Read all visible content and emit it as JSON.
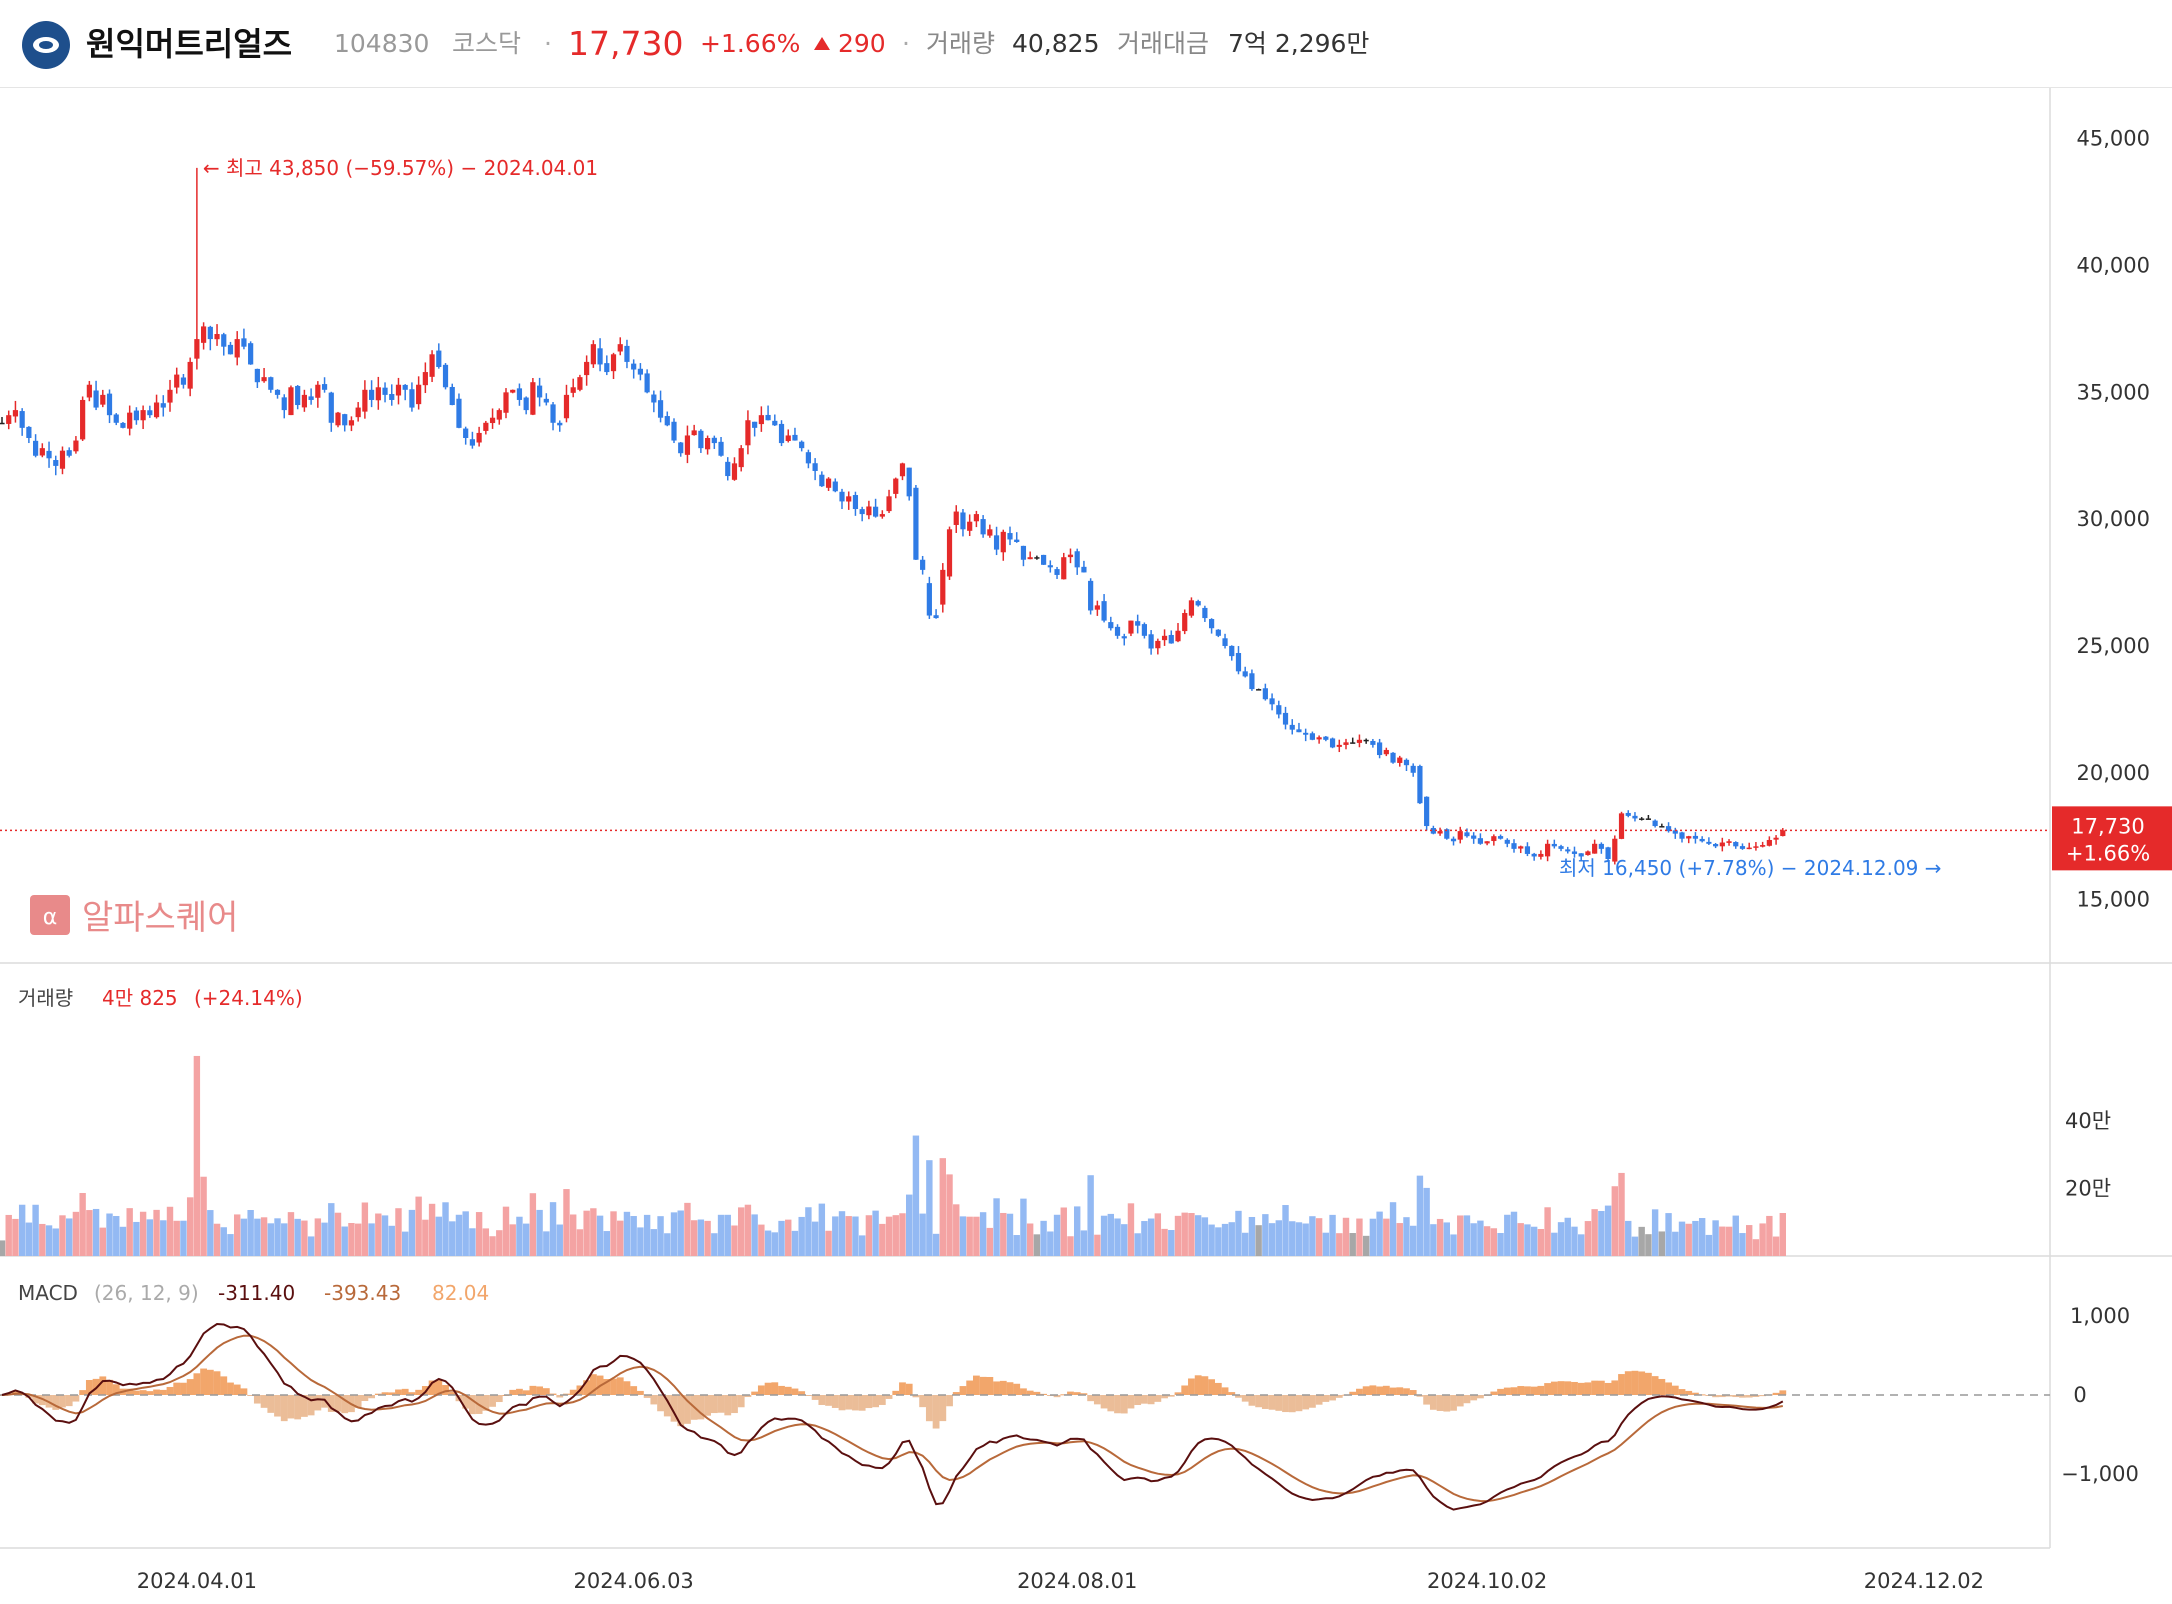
{
  "header": {
    "name": "원익머트리얼즈",
    "code": "104830",
    "market": "코스닥",
    "dot": "·",
    "price": "17,730",
    "change_pct": "+1.66%",
    "change_amt": "290",
    "volume_label": "거래량",
    "volume_value": "40,825",
    "amount_label": "거래대금",
    "amount_value": "7억 2,296만"
  },
  "watermark": {
    "icon": "α",
    "text": "알파스퀘어"
  },
  "colors": {
    "up": "#e52a2a",
    "down": "#2f7be5",
    "flat": "#222222",
    "vol_up": "#f4a3a3",
    "vol_down": "#93b9f3",
    "vol_flat": "#a7a7a7",
    "macd": "#5a0f0f",
    "signal": "#b8693a",
    "hist_pos": "#f2a66b",
    "hist_neg": "#ebbd98"
  },
  "chart_data": {
    "type": "candlestick",
    "price_axis": {
      "ticks": [
        "45,000",
        "40,000",
        "35,000",
        "30,000",
        "25,000",
        "20,000",
        "15,000"
      ],
      "values": [
        45000,
        40000,
        35000,
        30000,
        25000,
        20000,
        15000
      ],
      "range": [
        12500,
        47000
      ]
    },
    "date_ticks": [
      "2024.04.01",
      "2024.06.03",
      "2024.08.01",
      "2024.10.02",
      "2024.12.02"
    ],
    "date_tick_index": [
      29,
      94,
      160,
      221,
      286
    ],
    "current_price": {
      "label": "17,730",
      "pct": "+1.66%",
      "value": 17730
    },
    "high_annotation": {
      "text": "← 최고 43,850 (−59.57%) − 2024.04.01",
      "value": 43850,
      "index": 29
    },
    "low_annotation": {
      "text": "최저 16,450 (+7.78%) − 2024.12.09 →",
      "value": 16450,
      "index": 291
    },
    "close": [
      33800,
      34100,
      34300,
      33600,
      33200,
      32500,
      32800,
      32400,
      32100,
      32700,
      32500,
      33100,
      34700,
      35300,
      34400,
      34900,
      34100,
      33800,
      33600,
      34200,
      33900,
      34300,
      34100,
      34600,
      34400,
      35100,
      35700,
      35300,
      36200,
      37100,
      37600,
      37100,
      37300,
      36800,
      36500,
      37100,
      36800,
      36100,
      35400,
      35600,
      35100,
      34900,
      34300,
      35200,
      34500,
      34900,
      34700,
      35300,
      35100,
      33800,
      34200,
      33700,
      33900,
      34400,
      35100,
      34700,
      35200,
      34900,
      34700,
      35300,
      35100,
      34400,
      35300,
      35800,
      36500,
      36000,
      35200,
      34500,
      33600,
      33200,
      32900,
      33400,
      33800,
      34000,
      34300,
      35000,
      35100,
      34700,
      34300,
      35400,
      34800,
      34600,
      33800,
      33700,
      34900,
      35200,
      35600,
      36200,
      36900,
      36100,
      35800,
      36500,
      36900,
      36200,
      35900,
      35700,
      35000,
      34600,
      34000,
      33700,
      33100,
      32600,
      33300,
      33500,
      32800,
      33200,
      33000,
      32500,
      31700,
      32200,
      32800,
      33900,
      33600,
      34100,
      33900,
      33700,
      33000,
      33300,
      33100,
      32800,
      32200,
      31900,
      31300,
      31600,
      31100,
      30700,
      30900,
      30400,
      30200,
      30500,
      30100,
      30200,
      30900,
      31600,
      32200,
      30900,
      28400,
      28000,
      26200,
      26100,
      28000,
      29600,
      30300,
      29600,
      29900,
      30200,
      29400,
      29600,
      28800,
      29500,
      29200,
      29100,
      28400,
      28500,
      28500,
      28200,
      28100,
      27800,
      28500,
      28600,
      28100,
      27900,
      26400,
      26600,
      26000,
      25700,
      25400,
      25300,
      26000,
      25800,
      25400,
      24900,
      25200,
      25400,
      25100,
      25600,
      26300,
      26800,
      26600,
      26100,
      25700,
      25400,
      25000,
      24600,
      24000,
      23800,
      23300,
      23300,
      22900,
      22700,
      22300,
      21900,
      21700,
      21600,
      21500,
      21300,
      21400,
      21300,
      21000,
      21100,
      21200,
      21200,
      21300,
      21300,
      21100,
      20700,
      20900,
      20400,
      20600,
      20300,
      20000,
      18800,
      17900,
      17600,
      17700,
      17400,
      17300,
      17700,
      17500,
      17400,
      17200,
      17300,
      17500,
      17400,
      17200,
      17000,
      17100,
      16800,
      16700,
      16800,
      17200,
      17100,
      17000,
      16900,
      16800,
      16700,
      16900,
      17200,
      17000,
      16600,
      17400,
      18400,
      18300,
      18200,
      18200,
      18200,
      17900,
      17900,
      17700,
      17600,
      17400,
      17500,
      17400,
      17300,
      17200,
      17100,
      17250,
      17300,
      17100,
      17000,
      17050,
      17100,
      17150,
      17350,
      17440,
      17730
    ],
    "x": "trading days 2024.03 – 2024.12, one value per day",
    "volume_axis": {
      "ticks": [
        "40만",
        "20만"
      ],
      "values": [
        400000,
        200000
      ]
    },
    "volume_legend": {
      "label": "거래량",
      "value": "4만 825",
      "pct": "(+24.14%)"
    },
    "macd_axis": {
      "ticks": [
        "1,000",
        "0",
        "−1,000"
      ],
      "values": [
        1000,
        0,
        -1000
      ]
    },
    "macd_legend": {
      "label": "MACD",
      "params": "(26, 12, 9)",
      "macd": "-311.40",
      "signal": "-393.43",
      "hist": "82.04"
    }
  }
}
